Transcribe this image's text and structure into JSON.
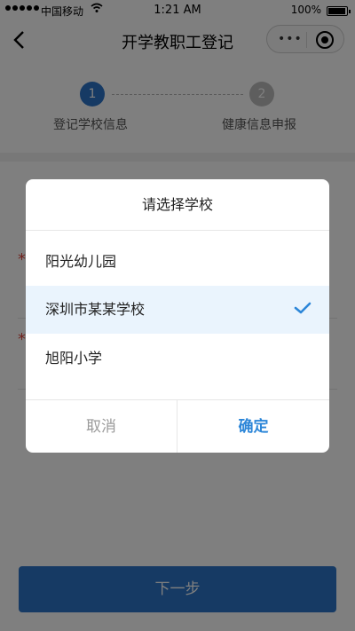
{
  "status_bar": {
    "carrier": "中国移动",
    "time": "1:21 AM",
    "battery": "100%"
  },
  "nav": {
    "title": "开学教职工登记"
  },
  "steps": [
    {
      "number": "1",
      "label": "登记学校信息"
    },
    {
      "number": "2",
      "label": "健康信息申报"
    }
  ],
  "form": {
    "next_label": "下一步"
  },
  "dialog": {
    "title": "请选择学校",
    "options": [
      {
        "label": "阳光幼儿园"
      },
      {
        "label": "深圳市某某学校"
      },
      {
        "label": "旭阳小学"
      }
    ],
    "selected_index": 1,
    "cancel_label": "取消",
    "confirm_label": "确定"
  },
  "colors": {
    "accent": "#2c74c9",
    "confirm": "#2c86d8",
    "required": "#e0473d",
    "selected_bg": "#eaf4fd"
  }
}
